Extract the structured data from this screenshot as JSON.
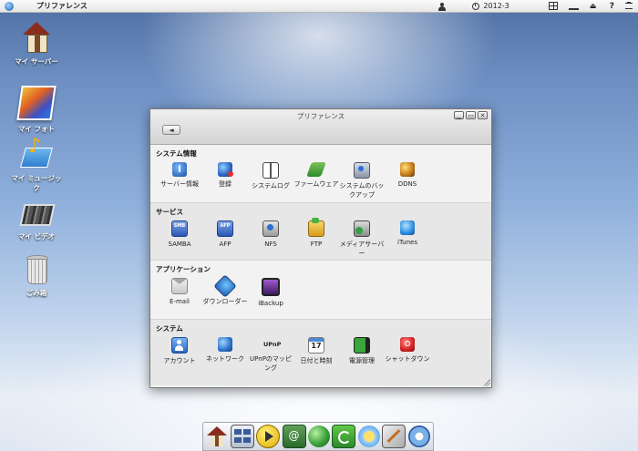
{
  "topbar": {
    "app_title": "プリファレンス",
    "clock_text": "2012-3",
    "icons": [
      "logo-icon",
      "user-icon",
      "clock-icon",
      "grid-icon",
      "tray-icon",
      "eject-icon",
      "help-icon",
      "menu-icon"
    ]
  },
  "desktop": [
    {
      "label": "マイ サーバー",
      "icon": "home-icon"
    },
    {
      "label": "マイ フォト",
      "icon": "photo-icon"
    },
    {
      "label": "マイ ミュージック",
      "icon": "music-icon"
    },
    {
      "label": "マイ ビデオ",
      "icon": "video-icon"
    },
    {
      "label": "ごみ箱",
      "icon": "trash-icon"
    }
  ],
  "window": {
    "title": "プリファレンス",
    "back_glyph": "◄",
    "controls": [
      "▁",
      "▭",
      "✕"
    ],
    "sections": [
      {
        "title": "システム情報",
        "items": [
          {
            "label": "サーバー情報",
            "icon": "info-icon"
          },
          {
            "label": "登録",
            "icon": "registration-icon"
          },
          {
            "label": "システムログ",
            "icon": "log-book-icon"
          },
          {
            "label": "ファームウェア",
            "icon": "firmware-icon"
          },
          {
            "label": "システムのバックアップ",
            "icon": "backup-icon"
          },
          {
            "label": "DDNS",
            "icon": "ddns-icon"
          }
        ]
      },
      {
        "title": "サービス",
        "items": [
          {
            "label": "SAMBA",
            "icon": "samba-icon",
            "badge": "SMB"
          },
          {
            "label": "AFP",
            "icon": "afp-icon",
            "badge": "AFP"
          },
          {
            "label": "NFS",
            "icon": "nfs-icon"
          },
          {
            "label": "FTP",
            "icon": "ftp-icon"
          },
          {
            "label": "メディアサーバー",
            "icon": "media-server-icon"
          },
          {
            "label": "iTunes",
            "icon": "itunes-icon"
          }
        ]
      },
      {
        "title": "アプリケーション",
        "items": [
          {
            "label": "E-mail",
            "icon": "email-icon"
          },
          {
            "label": "ダウンローダー",
            "icon": "downloader-icon"
          },
          {
            "label": "iBackup",
            "icon": "ibackup-icon"
          }
        ]
      },
      {
        "title": "システム",
        "items": [
          {
            "label": "アカウント",
            "icon": "account-icon"
          },
          {
            "label": "ネットワーク",
            "icon": "network-icon"
          },
          {
            "label": "UPnPのマッピング",
            "icon": "upnp-icon",
            "badge": "UPnP"
          },
          {
            "label": "日付と時刻",
            "icon": "calendar-icon",
            "badge": "17"
          },
          {
            "label": "電源管理",
            "icon": "power-icon"
          },
          {
            "label": "シャットダウン",
            "icon": "shutdown-icon"
          }
        ]
      }
    ]
  },
  "dock": [
    "home-icon",
    "viewer-icon",
    "play-icon",
    "contacts-icon",
    "globe-icon",
    "sync-icon",
    "weather-icon",
    "tools-icon",
    "settings-icon"
  ],
  "contacts_glyph": "@",
  "help_glyph": "?",
  "colors": {
    "sky_top": "#4f6fa3",
    "window_bg": "#f2f2f2",
    "section_alt": "#e7e7e7"
  }
}
